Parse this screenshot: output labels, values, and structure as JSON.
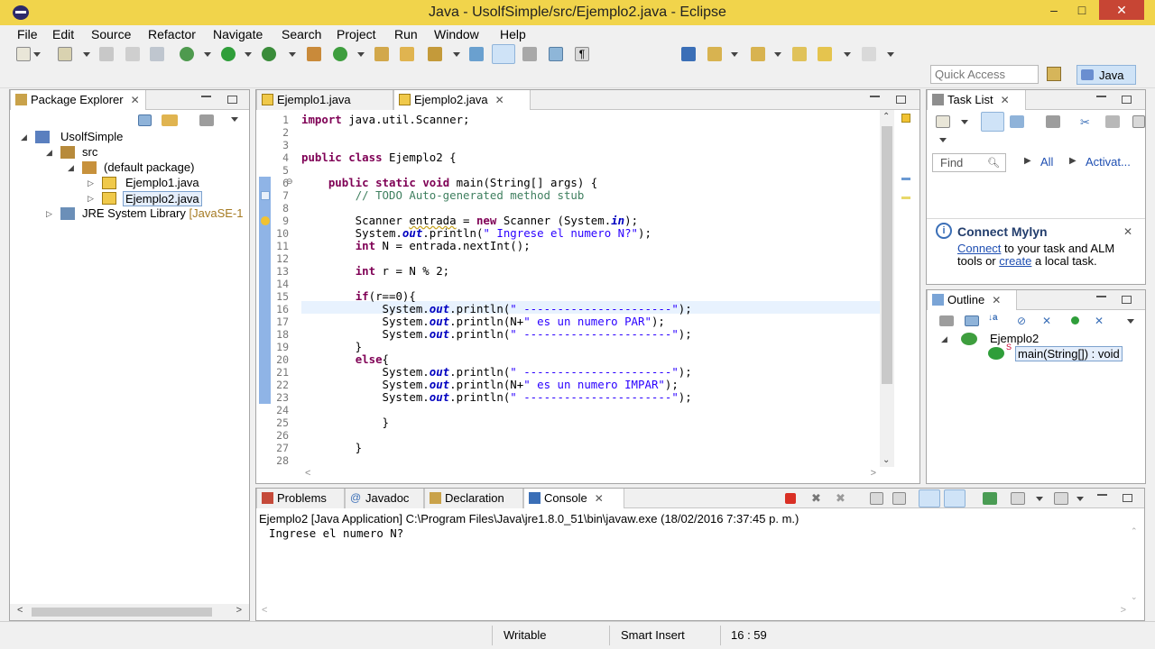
{
  "window": {
    "title": "Java - UsolfSimple/src/Ejemplo2.java - Eclipse",
    "minimize": "–",
    "maximize": "□",
    "close": "✕"
  },
  "menu": [
    "File",
    "Edit",
    "Source",
    "Refactor",
    "Navigate",
    "Search",
    "Project",
    "Run",
    "Window",
    "Help"
  ],
  "toolbar": {
    "quick_access_placeholder": "Quick Access",
    "perspective": "Java"
  },
  "package_explorer": {
    "tab": "Package Explorer",
    "tree": [
      {
        "label": "UsolfSimple",
        "icon": "project-icon",
        "level": 0,
        "twisty": "◢"
      },
      {
        "label": "src",
        "icon": "source-folder-icon",
        "level": 1,
        "twisty": "◢"
      },
      {
        "label": "(default package)",
        "icon": "package-icon",
        "level": 2,
        "twisty": "◢"
      },
      {
        "label": "Ejemplo1.java",
        "icon": "java-file-icon",
        "level": 3,
        "twisty": "▷"
      },
      {
        "label": "Ejemplo2.java",
        "icon": "java-file-icon",
        "level": 3,
        "twisty": "▷",
        "selected": true
      },
      {
        "label": "JRE System Library",
        "suffix": "[JavaSE-1",
        "icon": "library-icon",
        "level": 1,
        "twisty": "▷"
      }
    ]
  },
  "editor": {
    "tabs": [
      {
        "label": "Ejemplo1.java",
        "active": false
      },
      {
        "label": "Ejemplo2.java",
        "active": true
      }
    ],
    "current_line": 16,
    "lines": [
      "import java.util.Scanner;",
      "",
      "",
      "public class Ejemplo2 {",
      "",
      "    public static void main(String[] args) {",
      "        // TODO Auto-generated method stub",
      "",
      "        Scanner entrada = new Scanner (System.in);",
      "        System.out.println(\" Ingrese el numero N?\");",
      "        int N = entrada.nextInt();",
      "",
      "        int r = N % 2;",
      "",
      "        if(r==0){",
      "            System.out.println(\" ----------------------\");",
      "            System.out.println(N+\" es un numero PAR\");",
      "            System.out.println(\" ----------------------\");",
      "        }",
      "        else{",
      "            System.out.println(\" ----------------------\");",
      "            System.out.println(N+\" es un numero IMPAR\");",
      "            System.out.println(\" ----------------------\");",
      "",
      "            }",
      "",
      "        }",
      ""
    ]
  },
  "console": {
    "tabs": [
      {
        "label": "Problems",
        "active": false
      },
      {
        "label": "Javadoc",
        "active": false
      },
      {
        "label": "Declaration",
        "active": false
      },
      {
        "label": "Console",
        "active": true
      }
    ],
    "launch": "Ejemplo2 [Java Application] C:\\Program Files\\Java\\jre1.8.0_51\\bin\\javaw.exe (18/02/2016 7:37:45 p. m.)",
    "output": "Ingrese el numero N?"
  },
  "task_list": {
    "tab": "Task List",
    "find_placeholder": "Find",
    "filter_all": "All",
    "filter_activate": "Activat...",
    "mylyn_title": "Connect Mylyn",
    "mylyn_connect": "Connect",
    "mylyn_text1": " to your task and ALM tools or ",
    "mylyn_create": "create",
    "mylyn_text2": " a local task."
  },
  "outline": {
    "tab": "Outline",
    "class_name": "Ejemplo2",
    "method": "main(String[]) : void"
  },
  "status": {
    "writable": "Writable",
    "insert_mode": "Smart Insert",
    "position": "16 : 59"
  }
}
